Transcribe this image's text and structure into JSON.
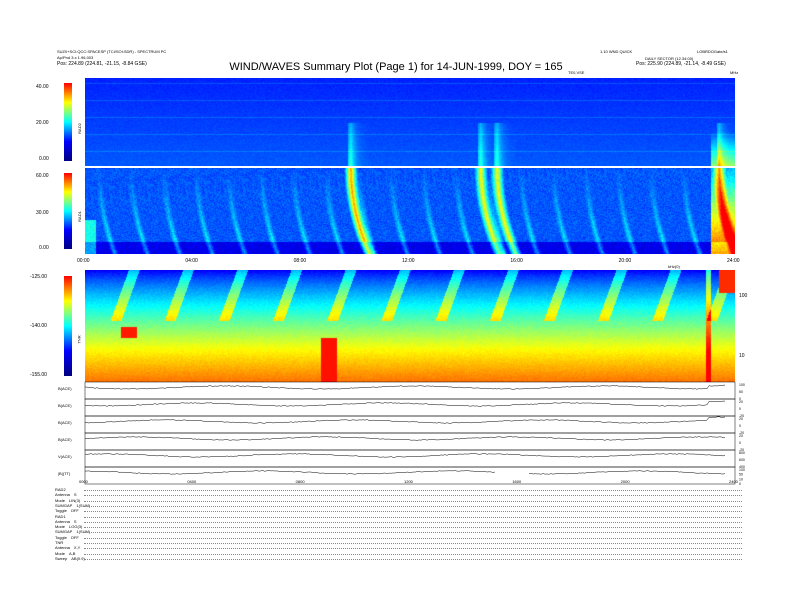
{
  "header": {
    "left_line1": "SUZ0+SCI:QCC:SPACESP (TCI/SOI:SDR) - SPECTRUM PC",
    "left_line2": "Ap/Pnd 3.x 1.96.003",
    "left_line3": "Pos:  224.89 (224.81, -21.15, -8.84 GSE)",
    "right_line1": "1.10 WND QUICK",
    "right_line2": "DAILY SECTOR (12.34:00)",
    "right_line3": "Pos:  225.90 (224.89, -21.14, -8.49 GSE)",
    "right_top": "LOBRDOGate/s1",
    "title": "WIND/WAVES Summary Plot (Page 1) for 14-JUN-1999, DOY = 165",
    "te_label": "TE0,VSE",
    "mhz_label": "MHz",
    "khz_label": "kHz(0)"
  },
  "chart_data": {
    "type": "heatmap",
    "title": "WIND/WAVES Summary Plot (Page 1) for 14-JUN-1999, DOY = 165",
    "x_time_ticks": [
      "00:00",
      "04:00",
      "08:00",
      "12:00",
      "16:00",
      "20:00",
      "24:00"
    ],
    "x_time_ticks_bottom": [
      "0000",
      "0400",
      "0800",
      "1200",
      "1600",
      "2000",
      "2400"
    ],
    "colormap": [
      "#000080",
      "#0000ff",
      "#00ffff",
      "#ffff00",
      "#ff0000"
    ],
    "panels": [
      {
        "name": "RAD2",
        "colorbar_ticks": [
          "40.00",
          "20.00",
          "0.00"
        ],
        "colorbar_range": [
          0,
          40
        ]
      },
      {
        "name": "RAD1",
        "colorbar_ticks": [
          "60.00",
          "30.00",
          "0.00"
        ],
        "colorbar_range": [
          0,
          60
        ]
      },
      {
        "name": "TNR",
        "colorbar_ticks": [
          "-125.00",
          "-140.00",
          "-155.00"
        ],
        "colorbar_range": [
          -155,
          -125
        ],
        "right_ticks": [
          "100",
          "10"
        ]
      }
    ],
    "event_bursts_hours": [
      9.8,
      14.6,
      15.2,
      23.4
    ],
    "line_panels": [
      {
        "label": "B(ACE)",
        "right_ticks": [
          "100",
          "50",
          "0"
        ]
      },
      {
        "label": "B(ACE)",
        "right_ticks": [
          "20",
          "0",
          "-20"
        ]
      },
      {
        "label": "B(ACE)",
        "right_ticks": [
          "20",
          "0",
          "-20"
        ]
      },
      {
        "label": "B(ACE)",
        "right_ticks": [
          "20",
          "0",
          "-20"
        ]
      },
      {
        "label": "V(ACE)",
        "right_ticks": [
          "800",
          "600",
          "400"
        ]
      },
      {
        "label": "|B|(TT)",
        "right_ticks": [
          "100",
          "50",
          "10",
          "0"
        ]
      }
    ]
  },
  "footer": [
    {
      "label": "RAD2",
      "value": ""
    },
    {
      "label": "Antenna",
      "value": "S"
    },
    {
      "label": "Mode",
      "value": "LIN(3)"
    },
    {
      "label": "SUMGAP",
      "value": "1(SUM)"
    },
    {
      "label": "Toggle",
      "value": "OFF"
    },
    {
      "label": "RAD1",
      "value": ""
    },
    {
      "label": "Antenna",
      "value": "S"
    },
    {
      "label": "Mode",
      "value": "LOG(3)"
    },
    {
      "label": "SUMGAP",
      "value": "1(SUM)"
    },
    {
      "label": "Toggle",
      "value": "OFF"
    },
    {
      "label": "TNR",
      "value": ""
    },
    {
      "label": "Antenna",
      "value": "X,Y"
    },
    {
      "label": "Mode",
      "value": "A,B"
    },
    {
      "label": "Sweep",
      "value": "AB(0.9)"
    }
  ]
}
